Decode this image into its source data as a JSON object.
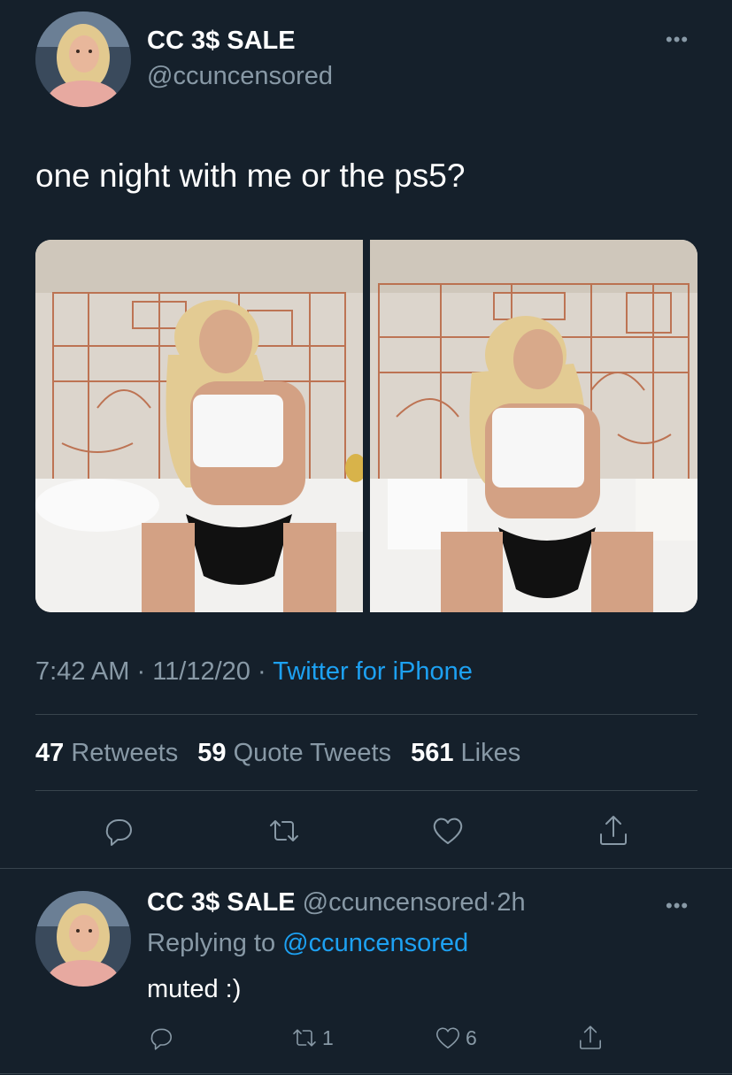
{
  "tweet": {
    "display_name": "CC 3$ SALE",
    "handle": "@ccuncensored",
    "text": "one night with me or the ps5?",
    "time": "7:42 AM",
    "separator": "·",
    "date": "11/12/20",
    "source": "Twitter for iPhone",
    "stats": {
      "retweets_count": "47",
      "retweets_label": "Retweets",
      "quotes_count": "59",
      "quotes_label": "Quote Tweets",
      "likes_count": "561",
      "likes_label": "Likes"
    },
    "photos": [
      {
        "icon": "photo-left"
      },
      {
        "icon": "photo-right"
      }
    ],
    "actions": [
      "reply-icon",
      "retweet-icon",
      "like-icon",
      "share-icon"
    ]
  },
  "reply": {
    "display_name": "CC 3$ SALE",
    "handle": "@ccuncensored",
    "separator": "·",
    "age": "2h",
    "replying_prefix": "Replying to",
    "replying_handle": "@ccuncensored",
    "text": "muted :)",
    "retweet_count": "1",
    "like_count": "6"
  },
  "colors": {
    "background": "#15202b",
    "text": "#ffffff",
    "secondary": "#8899a6",
    "link": "#1da1f2",
    "divider": "#38444d"
  }
}
